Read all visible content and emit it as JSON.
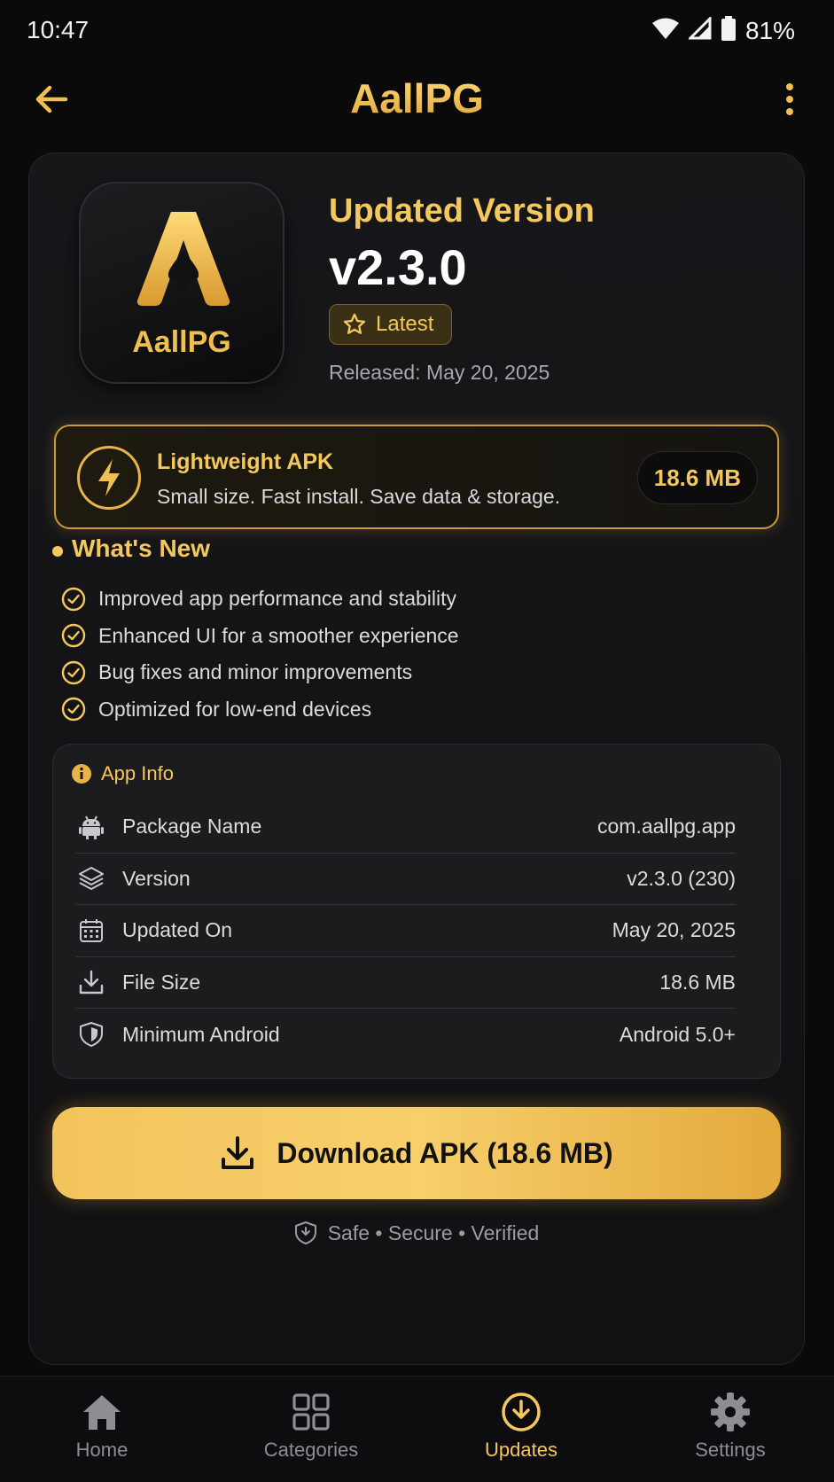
{
  "status_bar": {
    "time": "10:47",
    "battery": "81%"
  },
  "app_bar": {
    "title": "AallPG"
  },
  "app": {
    "icon_label": "AallPG",
    "version_header": "Updated Version",
    "version": "v2.3.0",
    "badge": "Latest",
    "released": "Released: May 20, 2025"
  },
  "lightweight": {
    "title": "Lightweight APK",
    "description": "Small size. Fast install. Save data & storage.",
    "size": "18.6 MB"
  },
  "whats_new": {
    "title": "What's New",
    "items": [
      "Improved app performance and stability",
      "Enhanced UI for a smoother experience",
      "Bug fixes and minor improvements",
      "Optimized for low-end devices"
    ]
  },
  "app_info": {
    "title": "App Info",
    "rows": [
      {
        "label": "Package Name",
        "value": "com.aallpg.app",
        "icon": "android-icon"
      },
      {
        "label": "Version",
        "value": "v2.3.0 (230)",
        "icon": "layers-icon"
      },
      {
        "label": "Updated On",
        "value": "May 20, 2025",
        "icon": "calendar-icon"
      },
      {
        "label": "File Size",
        "value": "18.6 MB",
        "icon": "download-tray-icon"
      },
      {
        "label": "Minimum Android",
        "value": "Android 5.0+",
        "icon": "shield-icon"
      }
    ]
  },
  "download": {
    "label": "Download APK (18.6 MB)"
  },
  "safe_text": "Safe • Secure • Verified",
  "nav": {
    "items": [
      {
        "label": "Home",
        "icon": "home-icon"
      },
      {
        "label": "Categories",
        "icon": "grid-icon"
      },
      {
        "label": "Updates",
        "icon": "update-icon"
      },
      {
        "label": "Settings",
        "icon": "gear-icon"
      }
    ],
    "active": "Updates"
  },
  "colors": {
    "accent": "#f5c85e",
    "accent_dark": "#e0a63a",
    "background": "#0a0a0b",
    "card": "#17171a",
    "muted_text": "#a7a7ab"
  }
}
